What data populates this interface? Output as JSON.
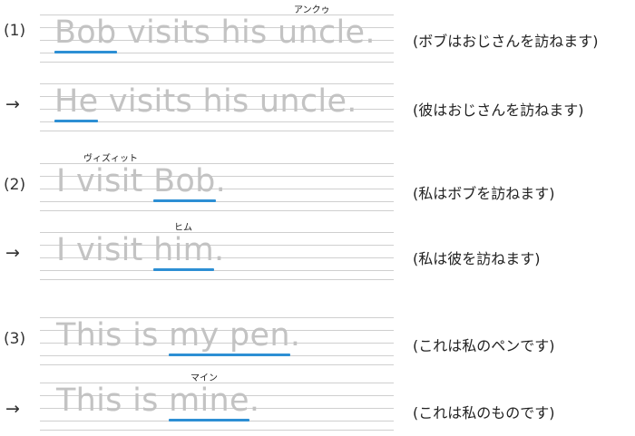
{
  "rows": [
    {
      "marker": "(1)",
      "sentence": {
        "pre": "",
        "ul": "Bob",
        "post": " visits his uncle."
      },
      "ruby": "アンクゥ",
      "translation": "(ボブはおじさんを訪ねます)"
    },
    {
      "marker": "→",
      "sentence": {
        "pre": "",
        "ul": "He",
        "post": " visits his uncle."
      },
      "ruby": "",
      "translation": "(彼はおじさんを訪ねます)"
    },
    {
      "marker": "(2)",
      "sentence": {
        "pre": "I visit ",
        "ul": "Bob",
        "post": "."
      },
      "ruby": "ヴィズィット",
      "translation": "(私はボブを訪ねます)"
    },
    {
      "marker": "→",
      "sentence": {
        "pre": "I visit ",
        "ul": "him",
        "post": "."
      },
      "ruby": "ヒム",
      "translation": "(私は彼を訪ねます)"
    },
    {
      "marker": "(3)",
      "sentence": {
        "pre": "This is ",
        "ul": "my pen",
        "post": "."
      },
      "ruby": "",
      "translation": "(これは私のペンです)"
    },
    {
      "marker": "→",
      "sentence": {
        "pre": "This is ",
        "ul": "mine",
        "post": "."
      },
      "ruby": "マイン",
      "translation": "(これは私のものです)"
    }
  ]
}
